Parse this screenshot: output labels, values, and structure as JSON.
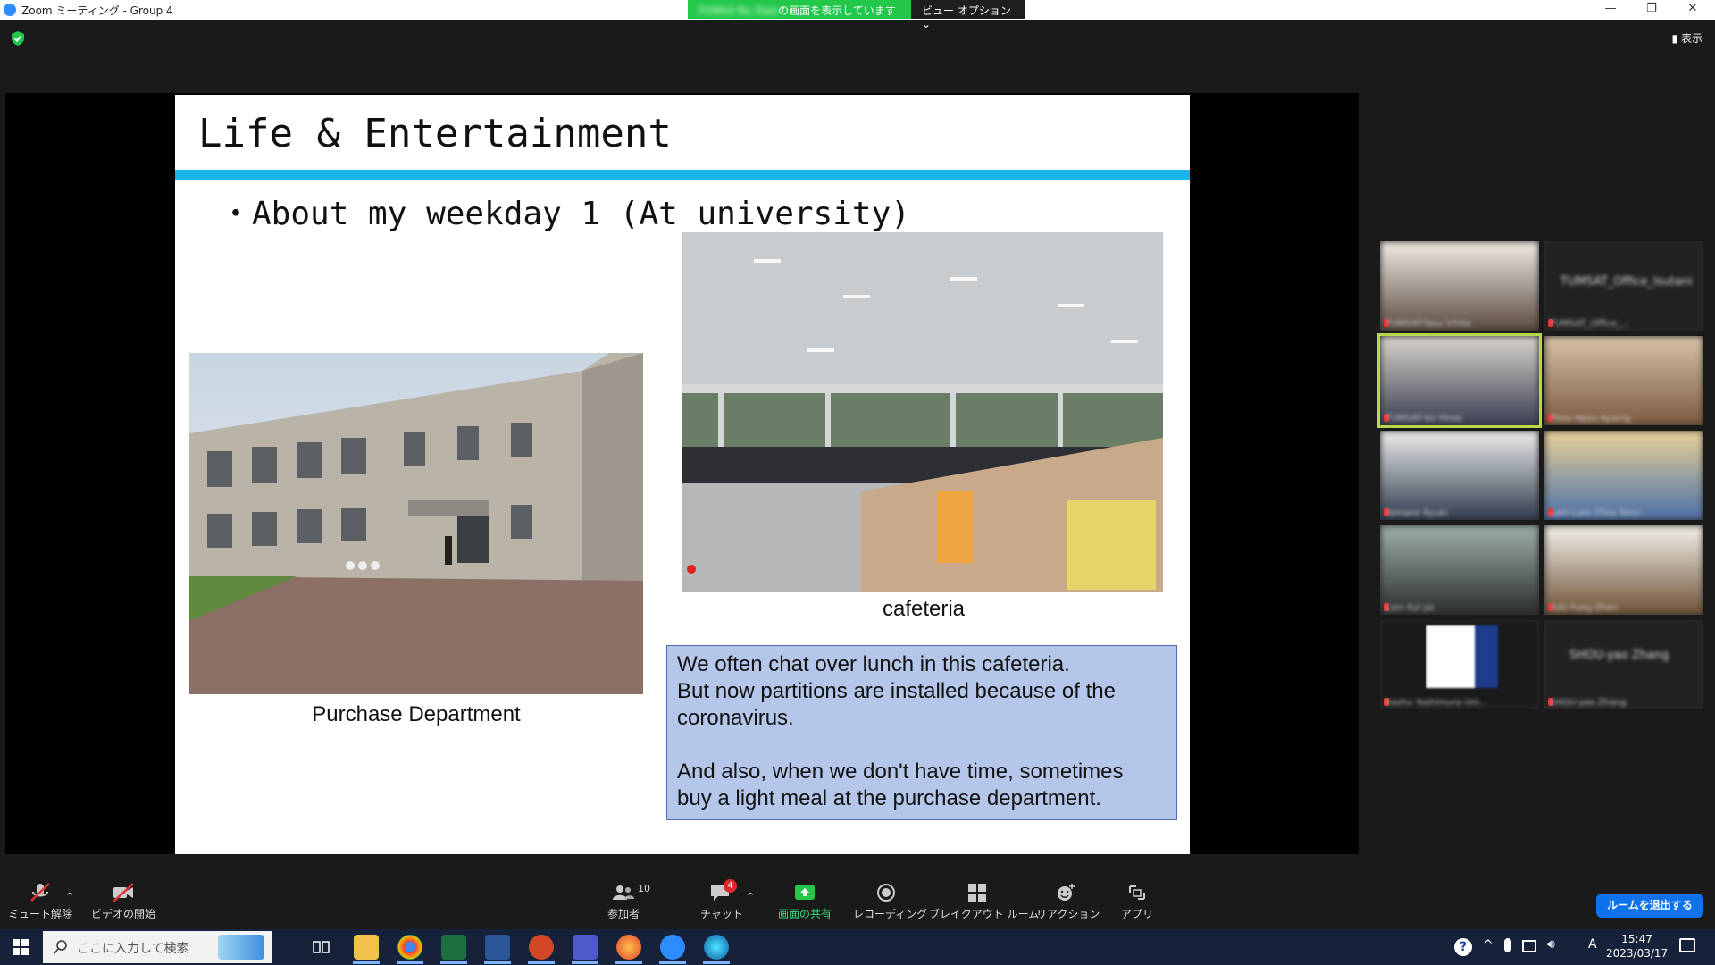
{
  "window": {
    "title": "Zoom ミーティング - Group 4",
    "share_banner_name": "FUWUI Ru Xiao",
    "share_banner_text": "の画面を表示しています",
    "view_options": "ビュー オプション ⌄",
    "view_button": "表示",
    "minimize": "—",
    "maximize": "❐",
    "close": "✕"
  },
  "slide": {
    "title": "Life & Entertainment",
    "bullet": "・About my weekday 1 (At university)",
    "caption_left": "Purchase Department",
    "caption_right": "cafeteria",
    "text_lines": [
      "We often chat over lunch in this cafeteria.",
      "But now partitions are installed because of the",
      "coronavirus.",
      "And also, when we don't have time, sometimes",
      "buy a light meal at the purchase department."
    ],
    "accent_color": "#18b4ea"
  },
  "participants": [
    {
      "name": "TUMSAT-Yasu Ichita"
    },
    {
      "name": "TUMSAT_Office_...",
      "label": "TUMSAT_Office_Isutani"
    },
    {
      "name": "TUMSAT-Ito Hiroe"
    },
    {
      "name": "Phoo Hpyu Kyaing"
    },
    {
      "name": "Yamane Ryuki"
    },
    {
      "name": "Lam Lam (Tina Tam)"
    },
    {
      "name": "Lien Kul Jai"
    },
    {
      "name": "Yuki Fung Zhen"
    },
    {
      "name": "Kashu Yoshimura Uni..."
    },
    {
      "name": "SHOU-yao Zhang",
      "label": "SHOU-yao Zhang"
    }
  ],
  "toolbar": {
    "mute": "ミュート解除",
    "video": "ビデオの開始",
    "participants": "参加者",
    "participants_count": "10",
    "chat": "チャット",
    "chat_badge": "4",
    "share": "画面の共有",
    "record": "レコーディング",
    "breakout": "ブレイクアウト ルーム",
    "reactions": "リアクション",
    "apps": "アプリ",
    "leave": "ルームを退出する"
  },
  "taskbar": {
    "search_placeholder": "ここに入力して検索",
    "time": "15:47",
    "date": "2023/03/17",
    "ime": "A"
  }
}
